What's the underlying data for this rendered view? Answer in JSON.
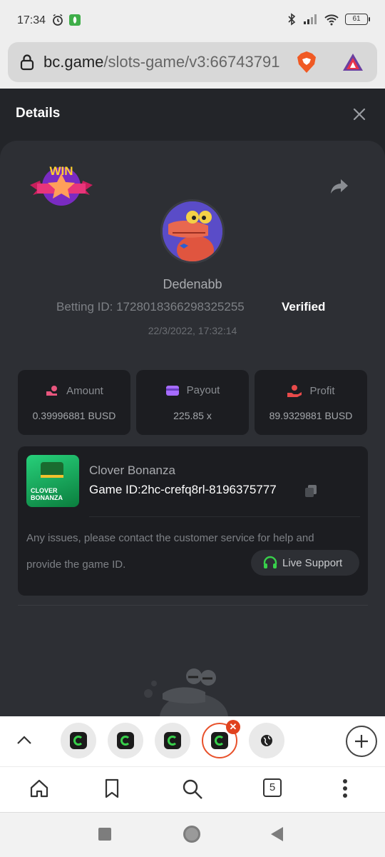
{
  "status_bar": {
    "time": "17:34",
    "battery": "61"
  },
  "browser": {
    "url_host": "bc.game",
    "url_path": "/slots-game/v3:66743791"
  },
  "details": {
    "title": "Details",
    "username": "Dedenabb",
    "betting_id": "Betting ID: 1728018366298325255",
    "verified": "Verified",
    "date": "22/3/2022, 17:32:14",
    "badge": "WIN"
  },
  "stats": [
    {
      "label": "Amount",
      "value": "0.39996881 BUSD",
      "icon": "amount-icon",
      "color": "#e8567e"
    },
    {
      "label": "Payout",
      "value": "225.85 x",
      "icon": "payout-card-icon",
      "color": "#a66cff"
    },
    {
      "label": "Profit",
      "value": "89.9329881 BUSD",
      "icon": "profit-hand-icon",
      "color": "#e84a4a"
    }
  ],
  "game": {
    "name": "Clover Bonanza",
    "game_id": "Game ID:2hc-crefq8rl-8196375777",
    "thumb_text": "CLOVER BONANZA",
    "support_line1": "Any issues, please contact the customer service for help and",
    "support_line2": "provide the game ID.",
    "live_support": "Live Support"
  },
  "tabs": {
    "count": "5",
    "open_thumbs": [
      "bc-game",
      "bc-game",
      "bc-game",
      "bc-game",
      "globe"
    ]
  },
  "colors": {
    "page_bg": "#232529",
    "card_bg": "#2d2f34",
    "box_bg": "#1c1d21",
    "accent_green": "#38d04b",
    "active_tab": "#e8512b"
  }
}
